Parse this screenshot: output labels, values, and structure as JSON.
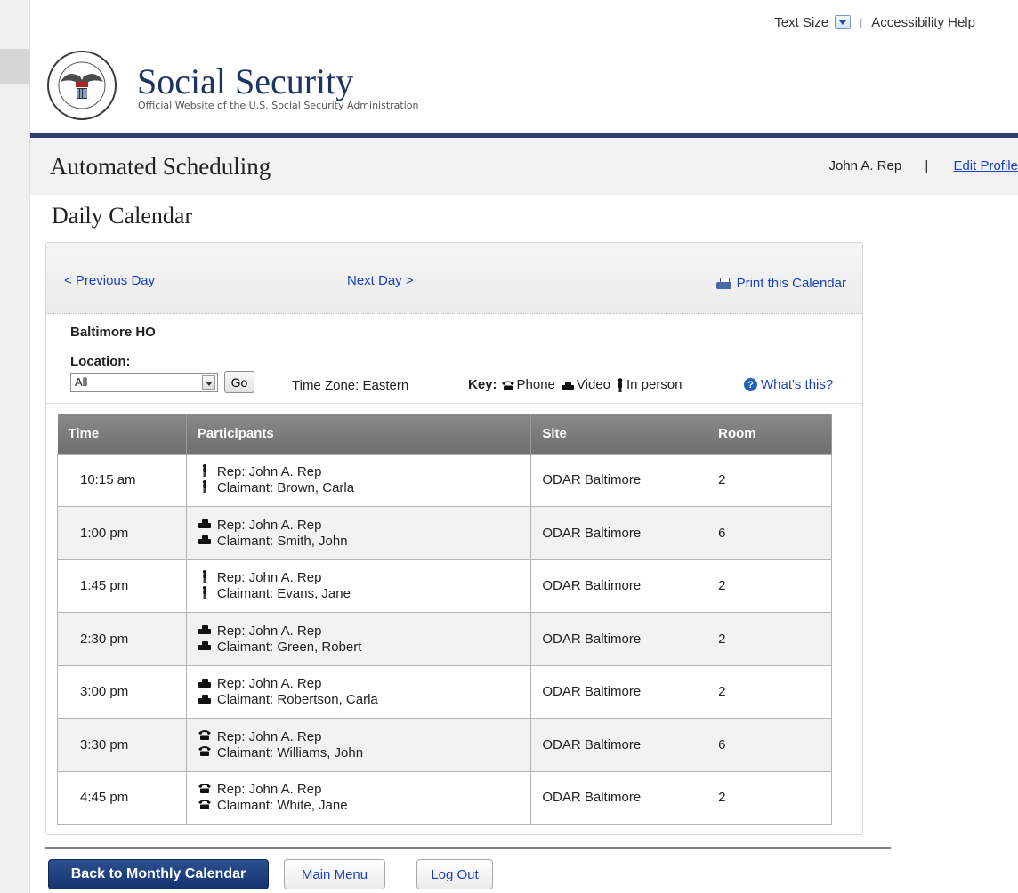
{
  "utility_bar": {
    "text_size_label": "Text Size",
    "accessibility_help": "Accessibility Help"
  },
  "brand": {
    "title": "Social Security",
    "subtitle": "Official Website of the U.S. Social Security Administration",
    "seal_text": "SOCIAL SECURITY ADMINISTRATION USA"
  },
  "app": {
    "title": "Automated Scheduling",
    "user_name": "John A. Rep",
    "separator": "|",
    "edit_profile": "Edit Profile"
  },
  "page": {
    "title": "Daily Calendar"
  },
  "calendar": {
    "prev_day": "< Previous Day",
    "next_day": "Next Day >",
    "print": "Print this Calendar",
    "office": "Baltimore HO",
    "location_label": "Location:",
    "location_value": "All",
    "go_button": "Go",
    "time_zone": "Time Zone: Eastern",
    "key_label": "Key:",
    "key_phone": "Phone",
    "key_video": "Video",
    "key_in_person": "In person",
    "whats_this": "What's this?"
  },
  "table": {
    "headers": [
      "Time",
      "Participants",
      "Site",
      "Room"
    ],
    "rows": [
      {
        "time": "10:15 am",
        "mode": "in_person",
        "rep": "Rep: John A. Rep",
        "claimant": "Claimant: Brown, Carla",
        "site": "ODAR Baltimore",
        "room": "2"
      },
      {
        "time": "1:00 pm",
        "mode": "video",
        "rep": "Rep: John A. Rep",
        "claimant": "Claimant: Smith, John",
        "site": "ODAR Baltimore",
        "room": "6"
      },
      {
        "time": "1:45 pm",
        "mode": "in_person",
        "rep": "Rep: John A. Rep",
        "claimant": "Claimant: Evans, Jane",
        "site": "ODAR Baltimore",
        "room": "2"
      },
      {
        "time": "2:30 pm",
        "mode": "video",
        "rep": "Rep: John A. Rep",
        "claimant": "Claimant: Green, Robert",
        "site": "ODAR Baltimore",
        "room": "2"
      },
      {
        "time": "3:00 pm",
        "mode": "video",
        "rep": "Rep: John A. Rep",
        "claimant": "Claimant: Robertson, Carla",
        "site": "ODAR Baltimore",
        "room": "2"
      },
      {
        "time": "3:30 pm",
        "mode": "phone",
        "rep": "Rep: John A. Rep",
        "claimant": "Claimant: Williams, John",
        "site": "ODAR Baltimore",
        "room": "6"
      },
      {
        "time": "4:45 pm",
        "mode": "phone",
        "rep": "Rep: John A. Rep",
        "claimant": "Claimant: White, Jane",
        "site": "ODAR Baltimore",
        "room": "2"
      }
    ]
  },
  "footer": {
    "back_button": "Back to Monthly Calendar",
    "main_menu": "Main Menu",
    "log_out": "Log Out"
  },
  "colors": {
    "brand_navy": "#1d3560",
    "rule_navy": "#2f3e6b",
    "link_blue": "#1a3fc4",
    "primary_button": "#143470",
    "table_header": "#7d7d7d"
  }
}
